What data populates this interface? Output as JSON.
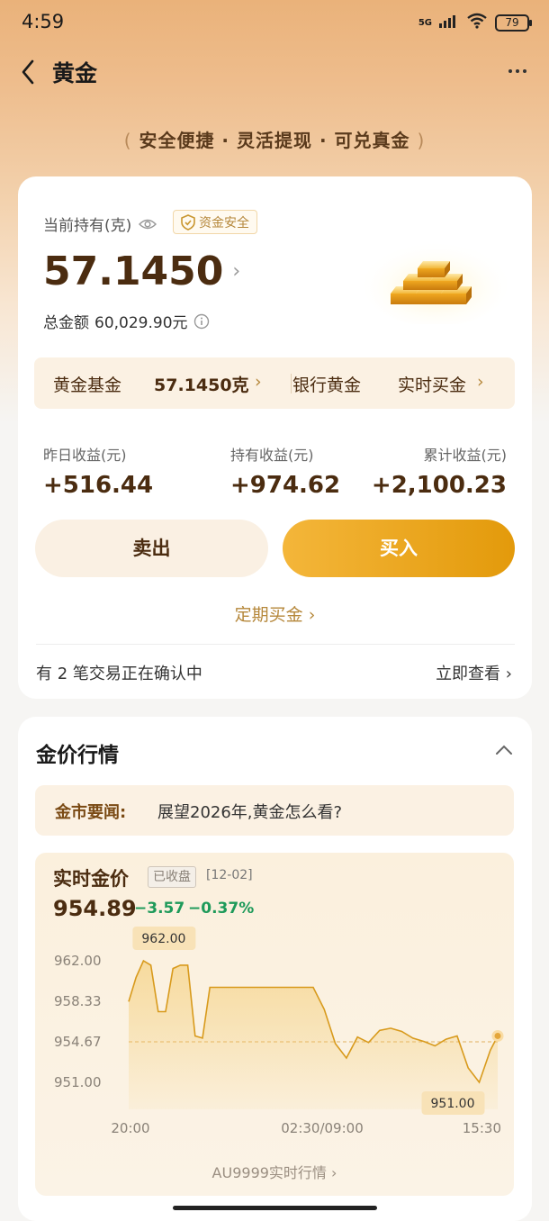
{
  "status": {
    "time": "4:59",
    "network": "5G",
    "battery": "79"
  },
  "nav": {
    "title": "黄金"
  },
  "slogan": "安全便捷 · 灵活提现 · 可兑真金",
  "holding": {
    "label": "当前持有(克)",
    "badge": "资金安全",
    "grams": "57.1450",
    "total_label": "总金额",
    "total_value": "60,029.90元"
  },
  "funds": {
    "fund_label": "黄金基金",
    "fund_grams": "57.1450克",
    "bank_label": "银行黄金",
    "realtime_label": "实时买金"
  },
  "earnings": [
    {
      "label": "昨日收益(元)",
      "value": "+516.44"
    },
    {
      "label": "持有收益(元)",
      "value": "+974.62"
    },
    {
      "label": "累计收益(元)",
      "value": "+2,100.23"
    }
  ],
  "actions": {
    "sell": "卖出",
    "buy": "买入",
    "regular": "定期买金"
  },
  "pending": {
    "text": "有 2 笔交易正在确认中",
    "link": "立即查看"
  },
  "market": {
    "title": "金价行情",
    "news_label": "金市要闻:",
    "news_text": "展望2026年,黄金怎么看?",
    "price_title": "实时金价",
    "closed_tag": "已收盘",
    "date": "[12-02]",
    "price": "954.89",
    "change": "−3.57",
    "change_pct": "−0.37%",
    "footer_link": "AU9999实时行情",
    "colors": {
      "up": "#e45b3a",
      "down": "#1e9a5a",
      "line": "#d89a1c"
    }
  },
  "chart_data": {
    "type": "line",
    "title": "实时金价",
    "xlabel": "",
    "ylabel": "",
    "y_ticks": [
      "962.00",
      "958.33",
      "954.67",
      "951.00"
    ],
    "x_ticks": [
      "20:00",
      "02:30/09:00",
      "15:30"
    ],
    "ylim": [
      951.0,
      962.0
    ],
    "reference_line": 954.67,
    "high_label": "962.00",
    "low_label": "951.00",
    "series": [
      {
        "name": "",
        "x": [
          0,
          2,
          4,
          6,
          8,
          10,
          12,
          14,
          16,
          18,
          20,
          22,
          24,
          26,
          28,
          30,
          32,
          35,
          38,
          41,
          44,
          47,
          50,
          53,
          56,
          59,
          62,
          65,
          68,
          71,
          74,
          77,
          80,
          83,
          86,
          89,
          92,
          95,
          98,
          100
        ],
        "values": [
          958.3,
          960.5,
          962.0,
          961.6,
          957.4,
          957.4,
          961.3,
          961.6,
          961.6,
          955.2,
          955.0,
          959.6,
          959.6,
          959.6,
          959.6,
          959.6,
          959.6,
          959.6,
          959.6,
          959.6,
          959.6,
          959.6,
          959.6,
          957.6,
          954.5,
          953.2,
          955.1,
          954.6,
          955.7,
          955.9,
          955.6,
          955.0,
          954.7,
          954.3,
          954.9,
          955.2,
          952.3,
          951.0,
          953.9,
          955.2
        ]
      }
    ]
  }
}
